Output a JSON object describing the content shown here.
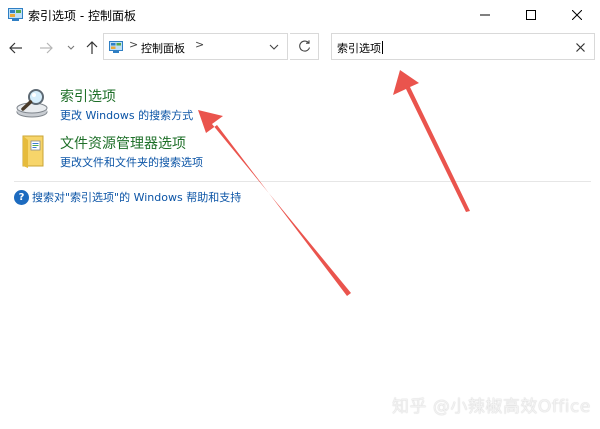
{
  "window": {
    "title": "索引选项 - 控制面板"
  },
  "navigation": {
    "address_path": "控制面板",
    "address_separator": ">",
    "search_value": "索引选项"
  },
  "results": [
    {
      "title": "索引选项",
      "subtitle": "更改 Windows 的搜索方式",
      "icon": "indexing-options-icon"
    },
    {
      "title": "文件资源管理器选项",
      "subtitle": "更改文件和文件夹的搜索选项",
      "icon": "folder-options-icon"
    }
  ],
  "help": {
    "text": "搜索对\"索引选项\"的 Windows 帮助和支持",
    "icon_glyph": "?"
  },
  "watermark": "知乎 @小辣椒高效Office",
  "colors": {
    "result_title": "#1e6f28",
    "link": "#0b54a6",
    "arrow": "#e8413a"
  }
}
